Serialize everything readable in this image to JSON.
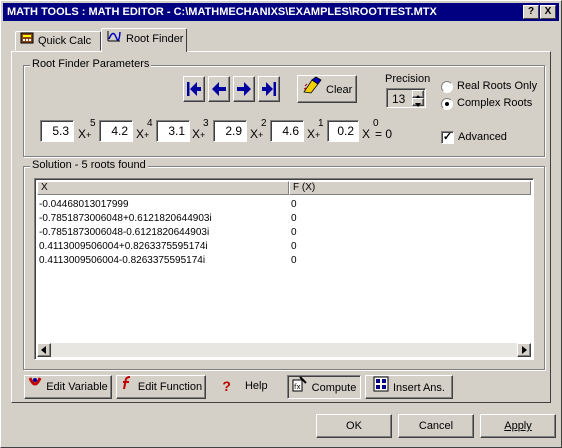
{
  "window": {
    "title": "MATH TOOLS : MATH EDITOR - C:\\MATHMECHANIXS\\EXAMPLES\\ROOTTEST.MTX",
    "help_glyph": "?",
    "close_glyph": "X"
  },
  "tabs": [
    {
      "label": "Quick Calc",
      "active": false
    },
    {
      "label": "Root Finder",
      "active": true
    }
  ],
  "params": {
    "group_label": "Root Finder Parameters",
    "clear_label": "Clear",
    "precision_label": "Precision",
    "precision_value": "13",
    "radio_real": "Real Roots Only",
    "radio_complex": "Complex Roots",
    "selected_radio": "complex",
    "advanced_label": "Advanced",
    "advanced_checked": true,
    "coefficients": [
      "5.3",
      "4.2",
      "3.1",
      "2.9",
      "4.6",
      "0.2"
    ],
    "powers": [
      "5",
      "4",
      "3",
      "2",
      "1",
      "0"
    ],
    "x_symbol": "X",
    "plus": "+",
    "equals": "= 0"
  },
  "solution": {
    "group_label": "Solution - 5 roots found",
    "columns": [
      "X",
      "F (X)"
    ],
    "rows": [
      {
        "x": "-0.04468013017999",
        "f": "0"
      },
      {
        "x": "-0.7851873006048+0.6121820644903i",
        "f": "0"
      },
      {
        "x": "-0.7851873006048-0.6121820644903i",
        "f": "0"
      },
      {
        "x": "0.4113009506004+0.8263375595174i",
        "f": "0"
      },
      {
        "x": "0.4113009506004-0.8263375595174i",
        "f": "0"
      }
    ]
  },
  "toolbar": {
    "edit_variable": "Edit Variable",
    "edit_function": "Edit Function",
    "help": "Help",
    "compute": "Compute",
    "insert_ans": "Insert Ans."
  },
  "dialog": {
    "ok": "OK",
    "cancel": "Cancel",
    "apply": "Apply"
  },
  "colors": {
    "titlebar": "#000080",
    "face": "#d4d0c8",
    "nav_arrow": "#0000a0"
  }
}
